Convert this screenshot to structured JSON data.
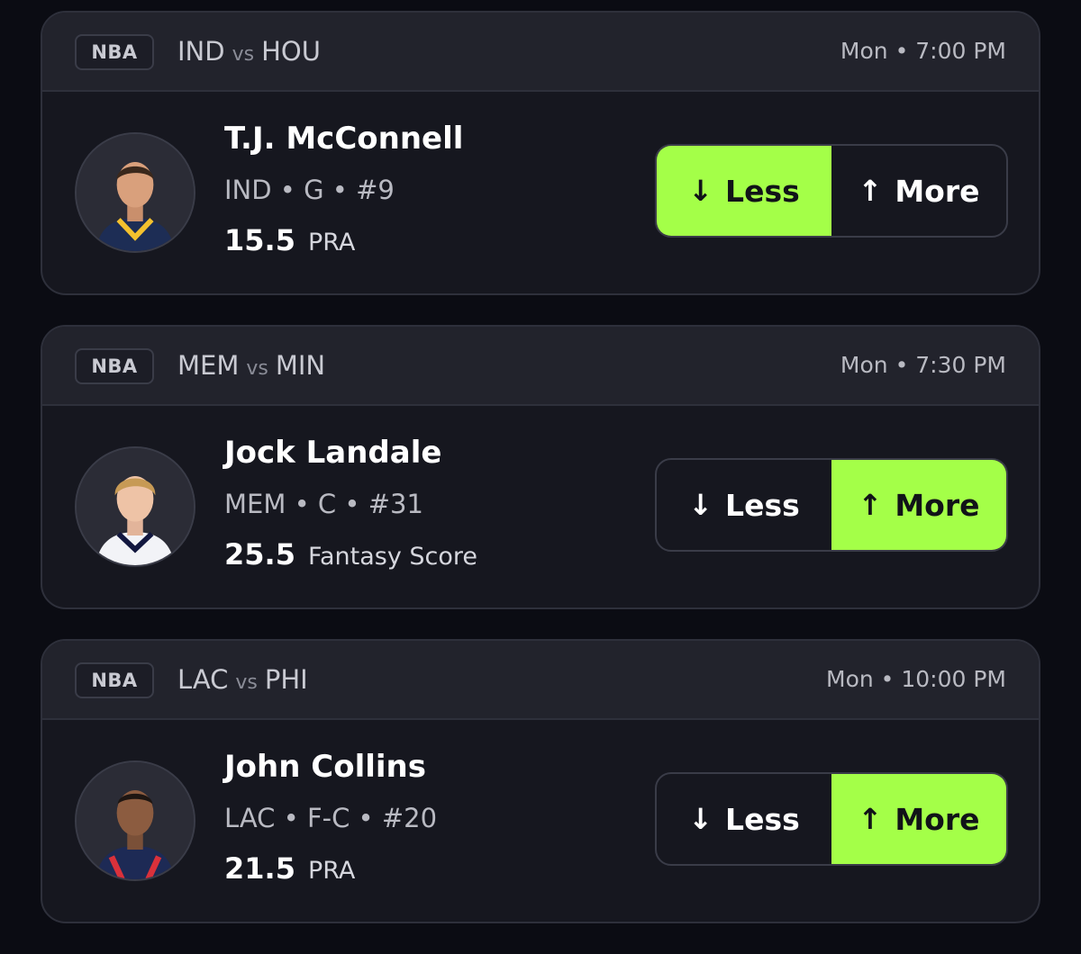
{
  "cards": [
    {
      "league": "NBA",
      "team_a": "IND",
      "vs": "vs",
      "team_b": "HOU",
      "time": "Mon • 7:00 PM",
      "player": {
        "name": "T.J. McConnell",
        "meta": "IND • G • #9",
        "line_value": "15.5",
        "stat": "PRA",
        "jersey_color": "#1d2d55",
        "jersey_trim": "#f4c12e"
      },
      "less": {
        "arrow": "↓",
        "label": "Less"
      },
      "more": {
        "arrow": "↑",
        "label": "More"
      },
      "selected": "less"
    },
    {
      "league": "NBA",
      "team_a": "MEM",
      "vs": "vs",
      "team_b": "MIN",
      "time": "Mon • 7:30 PM",
      "player": {
        "name": "Jock Landale",
        "meta": "MEM • C • #31",
        "line_value": "25.5",
        "stat": "Fantasy Score",
        "jersey_color": "#f2f3f7",
        "jersey_trim": "#12173f"
      },
      "less": {
        "arrow": "↓",
        "label": "Less"
      },
      "more": {
        "arrow": "↑",
        "label": "More"
      },
      "selected": "more"
    },
    {
      "league": "NBA",
      "team_a": "LAC",
      "vs": "vs",
      "team_b": "PHI",
      "time": "Mon • 10:00 PM",
      "player": {
        "name": "John Collins",
        "meta": "LAC • F-C • #20",
        "line_value": "21.5",
        "stat": "PRA",
        "jersey_color": "#1d2a55",
        "jersey_trim": "#d9313b"
      },
      "less": {
        "arrow": "↓",
        "label": "Less"
      },
      "more": {
        "arrow": "↑",
        "label": "More"
      },
      "selected": "more"
    }
  ],
  "colors": {
    "accent": "#a4ff48",
    "background": "#0b0c13",
    "card": "#16171f",
    "header": "#22232c"
  }
}
